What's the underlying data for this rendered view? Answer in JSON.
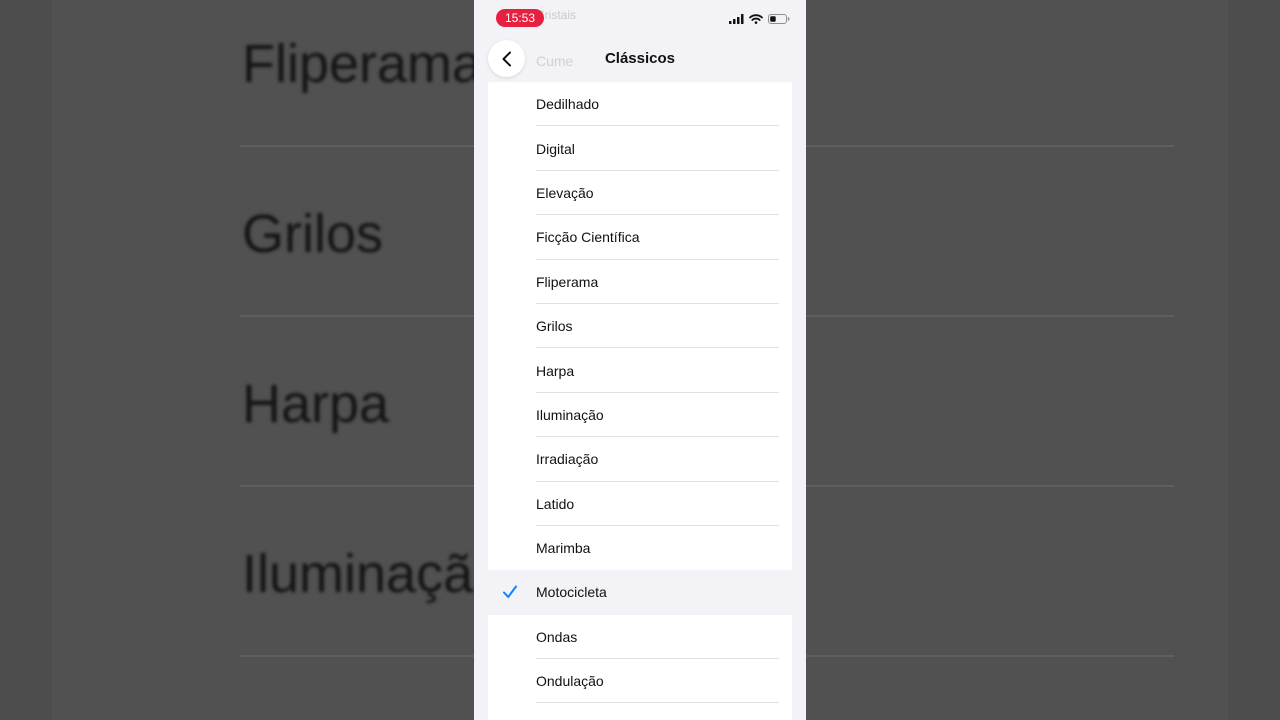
{
  "background": {
    "rows": [
      "Fliperama",
      "Grilos",
      "Harpa",
      "Iluminaçã"
    ]
  },
  "status_bar": {
    "time": "15:53",
    "icons": [
      "cellular-signal-icon",
      "wifi-icon",
      "battery-icon"
    ]
  },
  "ghost_text": {
    "top": "Cristais",
    "prev": "Cume"
  },
  "nav": {
    "title": "Clássicos",
    "back_icon": "chevron-left-icon"
  },
  "list": {
    "items": [
      {
        "label": "Dedilhado",
        "selected": false
      },
      {
        "label": "Digital",
        "selected": false
      },
      {
        "label": "Elevação",
        "selected": false
      },
      {
        "label": "Ficção Científica",
        "selected": false
      },
      {
        "label": "Fliperama",
        "selected": false
      },
      {
        "label": "Grilos",
        "selected": false
      },
      {
        "label": "Harpa",
        "selected": false
      },
      {
        "label": "Iluminação",
        "selected": false
      },
      {
        "label": "Irradiação",
        "selected": false
      },
      {
        "label": "Latido",
        "selected": false
      },
      {
        "label": "Marimba",
        "selected": false
      },
      {
        "label": "Motocicleta",
        "selected": true
      },
      {
        "label": "Ondas",
        "selected": false
      },
      {
        "label": "Ondulação",
        "selected": false
      }
    ]
  },
  "colors": {
    "accent": "#0a84ff",
    "time_pill": "#e5213f"
  }
}
